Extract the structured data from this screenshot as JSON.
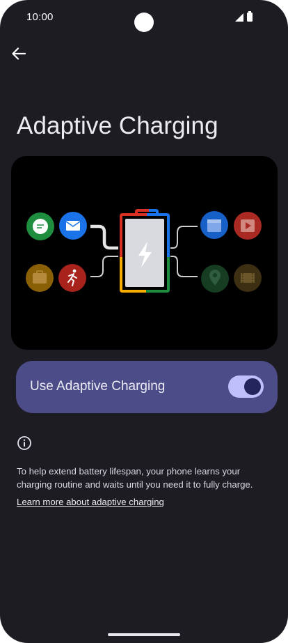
{
  "status_bar": {
    "time": "10:00",
    "icons": [
      "signal-icon",
      "battery-icon"
    ]
  },
  "toolbar": {
    "back_icon": "arrow-left-icon"
  },
  "page": {
    "title": "Adaptive Charging"
  },
  "illustration": {
    "left_apps": [
      "messages-icon",
      "mail-icon",
      "briefcase-icon",
      "running-icon"
    ],
    "right_apps": [
      "calendar-icon",
      "video-icon",
      "location-icon",
      "ticket-icon"
    ],
    "center": "battery-charging-icon",
    "colors": {
      "green": "#1e8e3e",
      "blue": "#1a73e8",
      "red": "#d93025",
      "yellow": "#f9ab00"
    }
  },
  "setting": {
    "label": "Use Adaptive Charging",
    "enabled": true
  },
  "info": {
    "icon": "info-icon",
    "description": "To help extend battery lifespan, your phone learns your charging routine and waits until you need it to fully charge.",
    "link_text": "Learn more about adaptive charging"
  },
  "colors": {
    "background": "#1d1c22",
    "card": "#4c4d88",
    "switch_track": "#bfc0fb",
    "switch_thumb": "#24255a"
  }
}
